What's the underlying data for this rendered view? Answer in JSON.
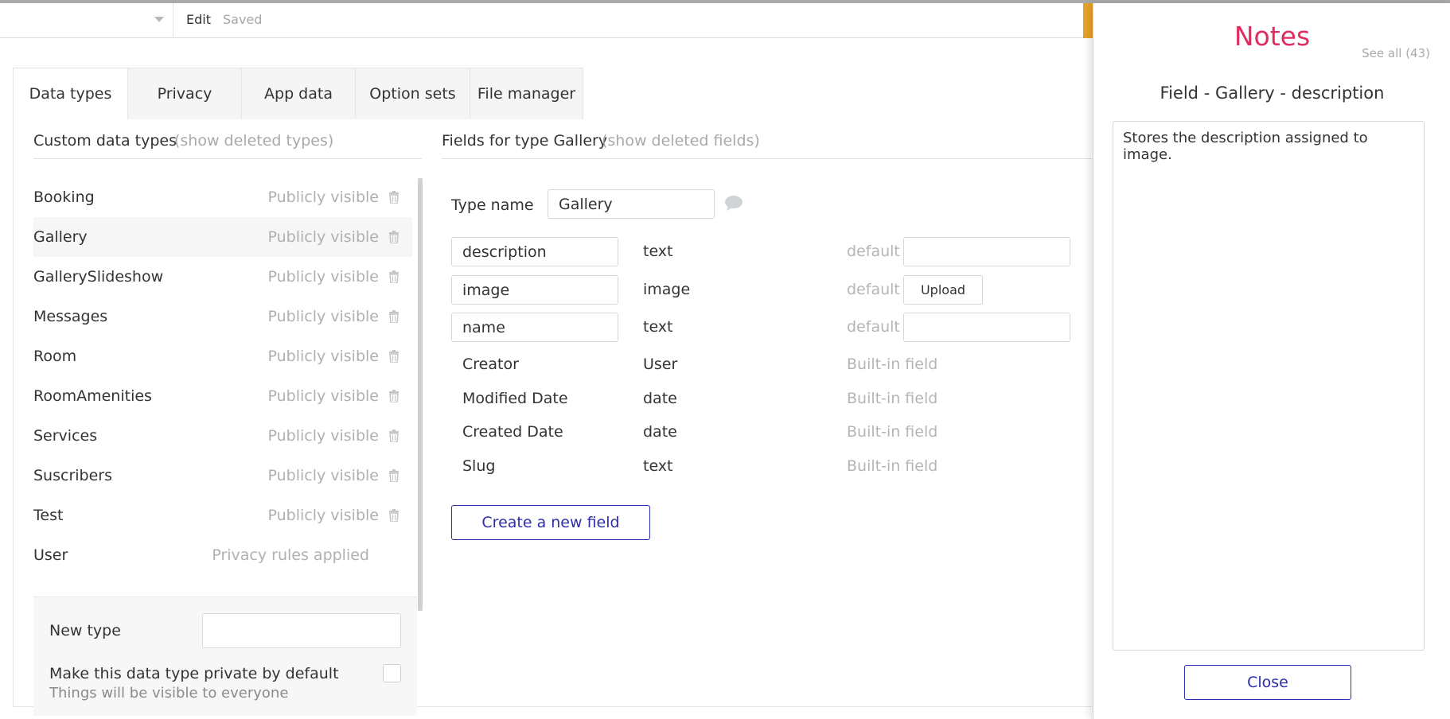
{
  "topbar": {
    "edit_label": "Edit",
    "saved_label": "Saved",
    "accent_color": "#e7a32b"
  },
  "tabs": [
    {
      "label": "Data types",
      "active": true
    },
    {
      "label": "Privacy"
    },
    {
      "label": "App data"
    },
    {
      "label": "Option sets"
    },
    {
      "label": "File manager"
    }
  ],
  "custom_types": {
    "title": "Custom data types",
    "show_deleted": "(show deleted types)",
    "items": [
      {
        "name": "Booking",
        "visibility": "Publicly visible"
      },
      {
        "name": "Gallery",
        "visibility": "Publicly visible",
        "selected": true
      },
      {
        "name": "GallerySlideshow",
        "visibility": "Publicly visible"
      },
      {
        "name": "Messages",
        "visibility": "Publicly visible"
      },
      {
        "name": "Room",
        "visibility": "Publicly visible"
      },
      {
        "name": "RoomAmenities",
        "visibility": "Publicly visible"
      },
      {
        "name": "Services",
        "visibility": "Publicly visible"
      },
      {
        "name": "Suscribers",
        "visibility": "Publicly visible"
      },
      {
        "name": "Test",
        "visibility": "Publicly visible"
      },
      {
        "name": "User",
        "visibility": "Privacy rules applied"
      }
    ]
  },
  "new_type": {
    "label": "New type",
    "input_value": "",
    "private_label": "Make this data type private by default",
    "private_sub": "Things will be visible to everyone",
    "private_checked": false
  },
  "fields": {
    "title": "Fields for type Gallery",
    "show_deleted": "(show deleted fields)",
    "type_name_label": "Type name",
    "type_name_value": "Gallery",
    "default_label": "default",
    "upload_label": "Upload",
    "builtin_label": "Built-in field",
    "custom": [
      {
        "name": "description",
        "type": "text",
        "default_kind": "input",
        "default_value": ""
      },
      {
        "name": "image",
        "type": "image",
        "default_kind": "upload"
      },
      {
        "name": "name",
        "type": "text",
        "default_kind": "input",
        "default_value": ""
      }
    ],
    "builtin": [
      {
        "name": "Creator",
        "type": "User"
      },
      {
        "name": "Modified Date",
        "type": "date"
      },
      {
        "name": "Created Date",
        "type": "date"
      },
      {
        "name": "Slug",
        "type": "text"
      }
    ],
    "create_label": "Create a new field"
  },
  "notes": {
    "title": "Notes",
    "see_all": "See all (43)",
    "heading": "Field - Gallery - description",
    "body": "Stores the description assigned to image.",
    "close_label": "Close",
    "title_color": "#e22b5f",
    "button_color": "#2d2dad"
  }
}
